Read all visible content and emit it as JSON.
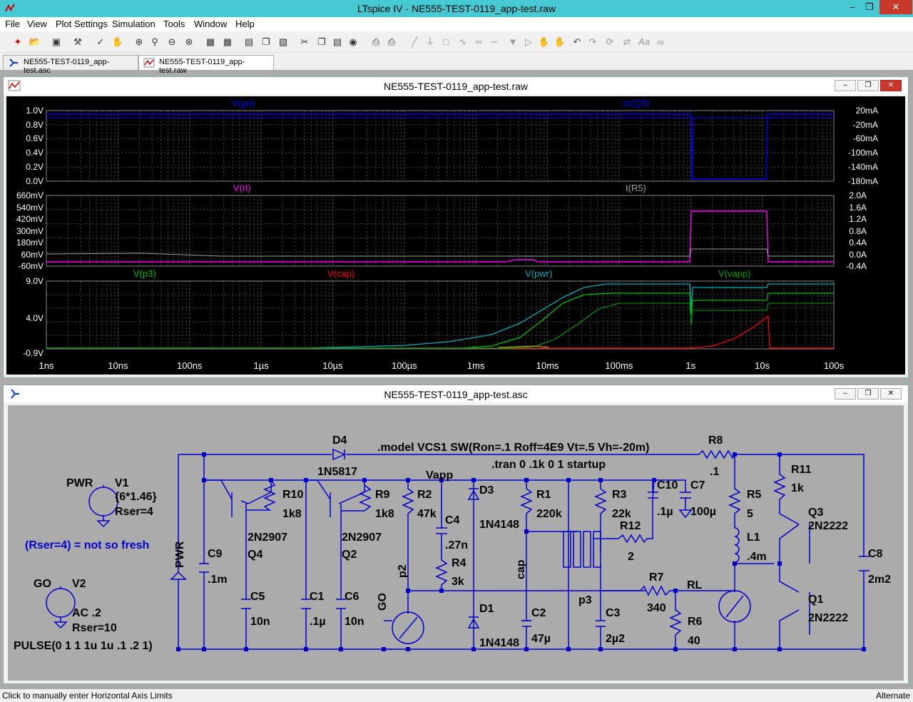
{
  "window": {
    "title": "LTspice IV - NE555-TEST-0119_app-test.raw"
  },
  "menu": [
    "File",
    "View",
    "Plot Settings",
    "Simulation",
    "Tools",
    "Window",
    "Help"
  ],
  "tabs": [
    {
      "label": "NE555-TEST-0119_app-test.asc"
    },
    {
      "label": "NE555-TEST-0119_app-test.raw"
    }
  ],
  "waveform": {
    "title": "NE555-TEST-0119_app-test.raw",
    "panes": [
      {
        "left_trace": "V(go)",
        "right_trace": "Ic(Q3)",
        "left_color": "#0000ff",
        "right_color": "#0000ff",
        "left_ticks": [
          "1.0V",
          "0.8V",
          "0.6V",
          "0.4V",
          "0.2V",
          "0.0V"
        ],
        "right_ticks": [
          "20mA",
          "-20mA",
          "-60mA",
          "-100mA",
          "-140mA",
          "-180mA"
        ]
      },
      {
        "left_trace": "V(rl)",
        "right_trace": "I(R5)",
        "left_color": "#ff00ff",
        "right_color": "#a0a0a0",
        "left_ticks": [
          "660mV",
          "540mV",
          "420mV",
          "300mV",
          "180mV",
          "60mV",
          "-60mV"
        ],
        "right_ticks": [
          "2.0A",
          "1.6A",
          "1.2A",
          "0.8A",
          "0.4A",
          "0.0A",
          "-0.4A"
        ]
      },
      {
        "traces": [
          {
            "name": "V(p3)",
            "color": "#00c000"
          },
          {
            "name": "V(cap)",
            "color": "#ff0000"
          },
          {
            "name": "V(pwr)",
            "color": "#00b0c0"
          },
          {
            "name": "V(vapp)",
            "color": "#00a000"
          }
        ],
        "left_ticks": [
          "9.0V",
          "4.0V",
          "-0.9V"
        ]
      }
    ],
    "x_ticks": [
      "1ns",
      "10ns",
      "100ns",
      "1µs",
      "10µs",
      "100µs",
      "1ms",
      "10ms",
      "100ms",
      "1s",
      "10s",
      "100s"
    ]
  },
  "schematic": {
    "title": "NE555-TEST-0119_app-test.asc",
    "labels": [
      "D4",
      "1N5817",
      ".model VCS1 SW(Ron=.1 Roff=4E9 Vt=.5 Vh=-20m)",
      ".tran 0 .1k 0 1 startup",
      "R8",
      ".1",
      "PWR",
      "V1",
      "{6*1.46}",
      "Rser=4",
      "(Rser=4) = not so fresh",
      "GO",
      "V2",
      "AC .2",
      "Rser=10",
      "PULSE(0 1 1 1u 1u .1 .2 1)",
      "Vapp",
      "R10",
      "1k8",
      "R9",
      "1k8",
      "R2",
      "47k",
      "D3",
      "1N4148",
      "R1",
      "220k",
      "R3",
      "22k",
      "C10",
      ".1µ",
      "C7",
      "100µ",
      "R11",
      "1k",
      "R5",
      "5",
      "L1",
      ".4m",
      "Q3",
      "2N2222",
      "C8",
      "2m2",
      "2N2907",
      "Q4",
      "2N2907",
      "Q2",
      "C4",
      ".27n",
      "R4",
      "3k",
      "R12",
      "2",
      "p2",
      "cap",
      "C9",
      ".1m",
      "C5",
      "10n",
      "C1",
      ".1µ",
      "C6",
      "10n",
      "D1",
      "1N4148",
      "C2",
      "47µ",
      "C3",
      "2µ2",
      "R7",
      "340",
      "RL",
      "R6",
      "40",
      "Q1",
      "2N2222",
      "p3",
      "GO",
      "PWR"
    ]
  },
  "status": {
    "left": "Click to manually enter Horizontal Axis Limits",
    "right": "Alternate"
  }
}
